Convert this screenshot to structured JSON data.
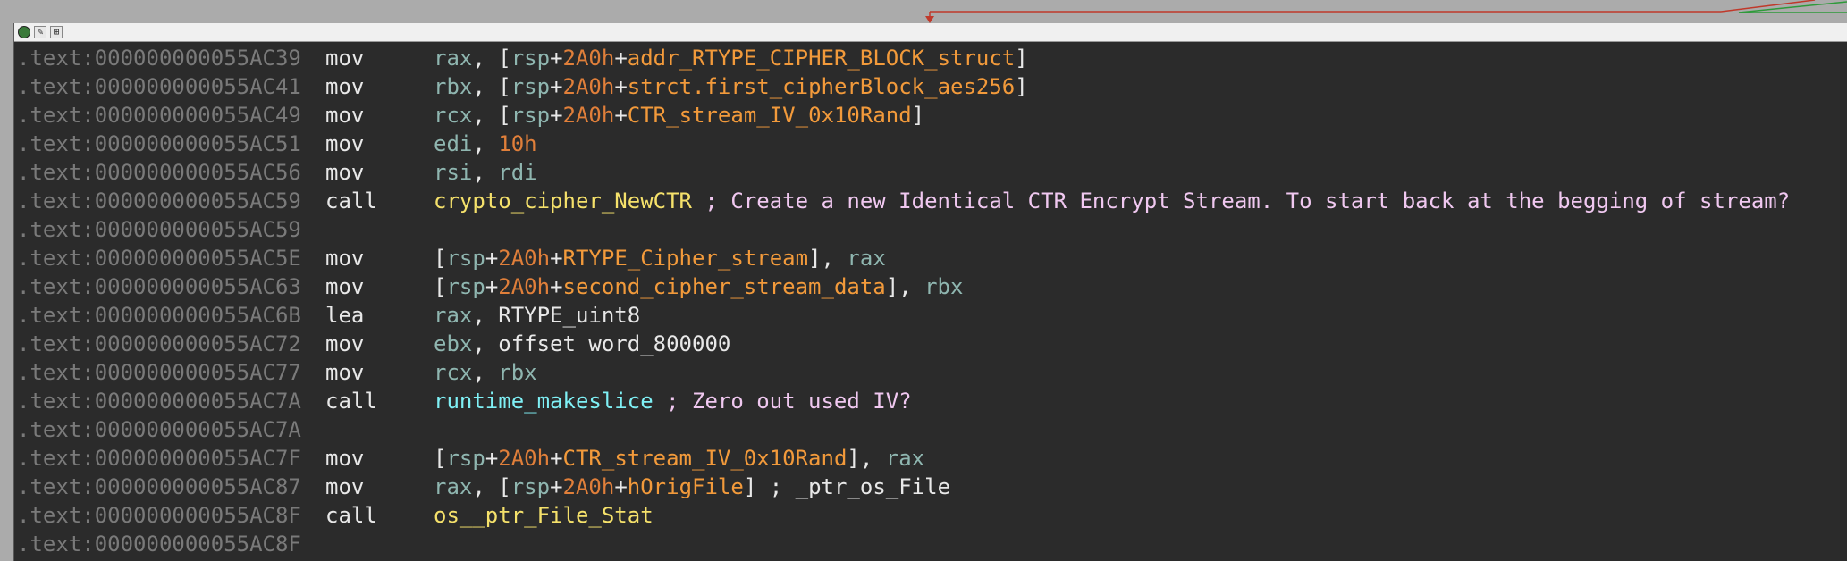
{
  "colors": {
    "background": "#ababab",
    "node_bg": "#2b2b2b",
    "address": "#7a7a7a",
    "register": "#8fb6b0",
    "immediate": "#e07f3a",
    "symbol": "#f29a3b",
    "function": "#f5e16b",
    "runtime_function": "#7ff0f5",
    "comment": "#f0c8f0",
    "edge_red": "#c0392b",
    "edge_green": "#2e9a3a"
  },
  "titlebar": {
    "icons": [
      "node-color-icon",
      "edit-icon",
      "graph-icon"
    ]
  },
  "lines": [
    {
      "addr": ".text:000000000055AC39",
      "mnem": "mov",
      "ops": [
        [
          "reg",
          "rax"
        ],
        [
          "pl",
          ", ["
        ],
        [
          "reg",
          "rsp"
        ],
        [
          "pl",
          "+"
        ],
        [
          "imm",
          "2A0h"
        ],
        [
          "pl",
          "+"
        ],
        [
          "sym",
          "addr_RTYPE_CIPHER_BLOCK_struct"
        ],
        [
          "pl",
          "]"
        ]
      ]
    },
    {
      "addr": ".text:000000000055AC41",
      "mnem": "mov",
      "ops": [
        [
          "reg",
          "rbx"
        ],
        [
          "pl",
          ", ["
        ],
        [
          "reg",
          "rsp"
        ],
        [
          "pl",
          "+"
        ],
        [
          "imm",
          "2A0h"
        ],
        [
          "pl",
          "+"
        ],
        [
          "sym",
          "strct.first_cipherBlock_aes256"
        ],
        [
          "pl",
          "]"
        ]
      ]
    },
    {
      "addr": ".text:000000000055AC49",
      "mnem": "mov",
      "ops": [
        [
          "reg",
          "rcx"
        ],
        [
          "pl",
          ", ["
        ],
        [
          "reg",
          "rsp"
        ],
        [
          "pl",
          "+"
        ],
        [
          "imm",
          "2A0h"
        ],
        [
          "pl",
          "+"
        ],
        [
          "sym",
          "CTR_stream_IV_0x10Rand"
        ],
        [
          "pl",
          "]"
        ]
      ]
    },
    {
      "addr": ".text:000000000055AC51",
      "mnem": "mov",
      "ops": [
        [
          "reg",
          "edi"
        ],
        [
          "pl",
          ", "
        ],
        [
          "imm",
          "10h"
        ]
      ]
    },
    {
      "addr": ".text:000000000055AC56",
      "mnem": "mov",
      "ops": [
        [
          "reg",
          "rsi"
        ],
        [
          "pl",
          ", "
        ],
        [
          "reg",
          "rdi"
        ]
      ]
    },
    {
      "addr": ".text:000000000055AC59",
      "mnem": "call",
      "ops": [
        [
          "fn",
          "crypto_cipher_NewCTR"
        ],
        [
          "cm",
          " ; Create a new Identical CTR Encrypt Stream. To start back at the begging of stream?"
        ]
      ]
    },
    {
      "addr": ".text:000000000055AC59",
      "mnem": "",
      "ops": []
    },
    {
      "addr": ".text:000000000055AC5E",
      "mnem": "mov",
      "ops": [
        [
          "pl",
          "["
        ],
        [
          "reg",
          "rsp"
        ],
        [
          "pl",
          "+"
        ],
        [
          "imm",
          "2A0h"
        ],
        [
          "pl",
          "+"
        ],
        [
          "sym",
          "RTYPE_Cipher_stream"
        ],
        [
          "pl",
          "], "
        ],
        [
          "reg",
          "rax"
        ]
      ]
    },
    {
      "addr": ".text:000000000055AC63",
      "mnem": "mov",
      "ops": [
        [
          "pl",
          "["
        ],
        [
          "reg",
          "rsp"
        ],
        [
          "pl",
          "+"
        ],
        [
          "imm",
          "2A0h"
        ],
        [
          "pl",
          "+"
        ],
        [
          "sym",
          "second_cipher_stream_data"
        ],
        [
          "pl",
          "], "
        ],
        [
          "reg",
          "rbx"
        ]
      ]
    },
    {
      "addr": ".text:000000000055AC6B",
      "mnem": "lea",
      "ops": [
        [
          "reg",
          "rax"
        ],
        [
          "pl",
          ", RTYPE_uint8"
        ]
      ]
    },
    {
      "addr": ".text:000000000055AC72",
      "mnem": "mov",
      "ops": [
        [
          "reg",
          "ebx"
        ],
        [
          "pl",
          ", offset word_800000"
        ]
      ]
    },
    {
      "addr": ".text:000000000055AC77",
      "mnem": "mov",
      "ops": [
        [
          "reg",
          "rcx"
        ],
        [
          "pl",
          ", "
        ],
        [
          "reg",
          "rbx"
        ]
      ]
    },
    {
      "addr": ".text:000000000055AC7A",
      "mnem": "call",
      "ops": [
        [
          "rt",
          "runtime_makeslice"
        ],
        [
          "cm",
          " ; Zero out used IV?"
        ]
      ]
    },
    {
      "addr": ".text:000000000055AC7A",
      "mnem": "",
      "ops": []
    },
    {
      "addr": ".text:000000000055AC7F",
      "mnem": "mov",
      "ops": [
        [
          "pl",
          "["
        ],
        [
          "reg",
          "rsp"
        ],
        [
          "pl",
          "+"
        ],
        [
          "imm",
          "2A0h"
        ],
        [
          "pl",
          "+"
        ],
        [
          "sym",
          "CTR_stream_IV_0x10Rand"
        ],
        [
          "pl",
          "], "
        ],
        [
          "reg",
          "rax"
        ]
      ]
    },
    {
      "addr": ".text:000000000055AC87",
      "mnem": "mov",
      "ops": [
        [
          "reg",
          "rax"
        ],
        [
          "pl",
          ", ["
        ],
        [
          "reg",
          "rsp"
        ],
        [
          "pl",
          "+"
        ],
        [
          "imm",
          "2A0h"
        ],
        [
          "pl",
          "+"
        ],
        [
          "sym",
          "hOrigFile"
        ],
        [
          "pl",
          "] ; _ptr_os_File"
        ]
      ]
    },
    {
      "addr": ".text:000000000055AC8F",
      "mnem": "call",
      "ops": [
        [
          "fn",
          "os__ptr_File_Stat"
        ]
      ]
    },
    {
      "addr": ".text:000000000055AC8F",
      "mnem": "",
      "ops": []
    }
  ]
}
